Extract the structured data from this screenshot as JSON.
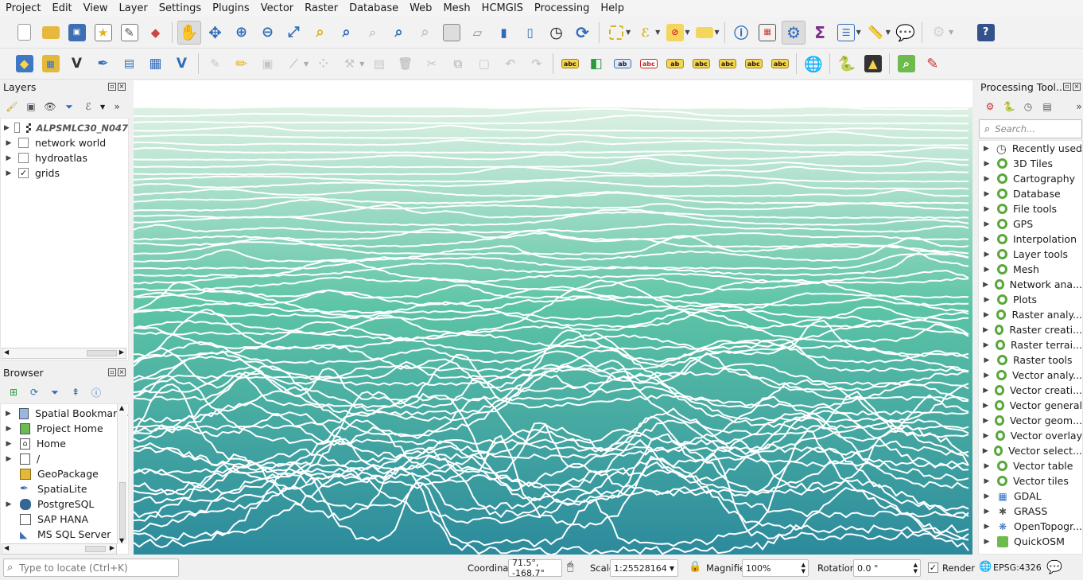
{
  "menu": [
    "Project",
    "Edit",
    "View",
    "Layer",
    "Settings",
    "Plugins",
    "Vector",
    "Raster",
    "Database",
    "Web",
    "Mesh",
    "HCMGIS",
    "Processing",
    "Help"
  ],
  "layers_panel": {
    "title": "Layers",
    "items": [
      {
        "label": "ALPSMLC30_N047",
        "checked": false,
        "italic": true,
        "icon": "raster-icon"
      },
      {
        "label": "network world",
        "checked": false,
        "italic": false,
        "icon": ""
      },
      {
        "label": "hydroatlas",
        "checked": false,
        "italic": false,
        "icon": ""
      },
      {
        "label": "grids",
        "checked": true,
        "italic": false,
        "icon": ""
      }
    ]
  },
  "browser_panel": {
    "title": "Browser",
    "items": [
      {
        "label": "Spatial Bookmarks",
        "icon": "bookmark-icon",
        "expandable": true
      },
      {
        "label": "Project Home",
        "icon": "project-home-icon",
        "expandable": true
      },
      {
        "label": "Home",
        "icon": "home-icon",
        "expandable": true
      },
      {
        "label": "/",
        "icon": "folder-icon",
        "expandable": true
      },
      {
        "label": "GeoPackage",
        "icon": "geopackage-icon",
        "expandable": false
      },
      {
        "label": "SpatiaLite",
        "icon": "spatialite-icon",
        "expandable": false
      },
      {
        "label": "PostgreSQL",
        "icon": "postgresql-icon",
        "expandable": true
      },
      {
        "label": "SAP HANA",
        "icon": "sap-hana-icon",
        "expandable": false
      },
      {
        "label": "MS SQL Server",
        "icon": "mssql-icon",
        "expandable": false
      }
    ]
  },
  "processing_panel": {
    "title": "Processing Tool...",
    "search_placeholder": "Search...",
    "items": [
      {
        "label": "Recently used",
        "icon": "clock-icon"
      },
      {
        "label": "3D Tiles",
        "icon": "qgis-icon"
      },
      {
        "label": "Cartography",
        "icon": "qgis-icon"
      },
      {
        "label": "Database",
        "icon": "qgis-icon"
      },
      {
        "label": "File tools",
        "icon": "qgis-icon"
      },
      {
        "label": "GPS",
        "icon": "qgis-icon"
      },
      {
        "label": "Interpolation",
        "icon": "qgis-icon"
      },
      {
        "label": "Layer tools",
        "icon": "qgis-icon"
      },
      {
        "label": "Mesh",
        "icon": "qgis-icon"
      },
      {
        "label": "Network ana...",
        "icon": "qgis-icon"
      },
      {
        "label": "Plots",
        "icon": "qgis-icon"
      },
      {
        "label": "Raster analy...",
        "icon": "qgis-icon"
      },
      {
        "label": "Raster creati...",
        "icon": "qgis-icon"
      },
      {
        "label": "Raster terrai...",
        "icon": "qgis-icon"
      },
      {
        "label": "Raster tools",
        "icon": "qgis-icon"
      },
      {
        "label": "Vector analy...",
        "icon": "qgis-icon"
      },
      {
        "label": "Vector creati...",
        "icon": "qgis-icon"
      },
      {
        "label": "Vector general",
        "icon": "qgis-icon"
      },
      {
        "label": "Vector geom...",
        "icon": "qgis-icon"
      },
      {
        "label": "Vector overlay",
        "icon": "qgis-icon"
      },
      {
        "label": "Vector select...",
        "icon": "qgis-icon"
      },
      {
        "label": "Vector table",
        "icon": "qgis-icon"
      },
      {
        "label": "Vector tiles",
        "icon": "qgis-icon"
      },
      {
        "label": "GDAL",
        "icon": "gdal-icon"
      },
      {
        "label": "GRASS",
        "icon": "grass-icon"
      },
      {
        "label": "OpenTopogr...",
        "icon": "opentopography-icon"
      },
      {
        "label": "QuickOSM",
        "icon": "quickosm-icon"
      }
    ]
  },
  "statusbar": {
    "locate_placeholder": "Type to locate (Ctrl+K)",
    "coordinate_label": "Coordinate",
    "coordinate_value": "71.5°, -168.7°",
    "scale_label": "Scale",
    "scale_value": "1:25528164",
    "magnifier_label": "Magnifier",
    "magnifier_value": "100%",
    "rotation_label": "Rotation",
    "rotation_value": "0.0 °",
    "render_label": "Render",
    "crs_label": "EPSG:4326"
  },
  "colors": {
    "map_top": "#d9efe0",
    "map_mid": "#5cc4a6",
    "map_bottom": "#2c8a9c",
    "qgis_green": "#58a83a",
    "accent_blue": "#2f6bb8"
  }
}
